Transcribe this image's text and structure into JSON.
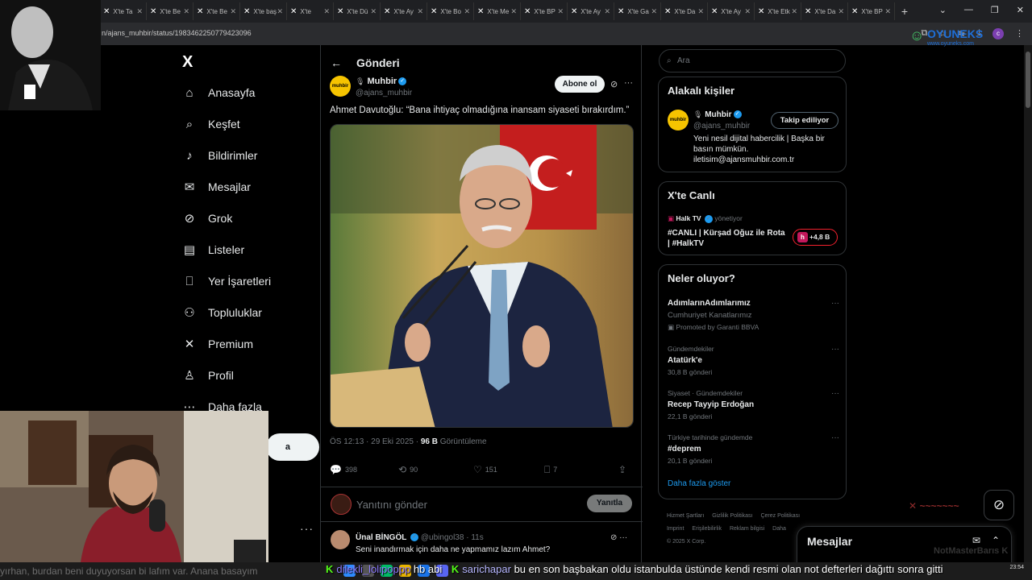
{
  "browser": {
    "tabs": [
      "X'te Ta",
      "X'te Be",
      "X'te Be",
      "X'te baş",
      "X'te",
      "X'te Dü",
      "X'te Ay",
      "X'te Bo",
      "X'te Me",
      "X'te BP",
      "X'te Ay",
      "X'te Ga",
      "X'te Da",
      "X'te Ay",
      "X'te Etk",
      "X'te Da",
      "X'te BP"
    ],
    "url": "n/ajans_muhbir/status/1983462250779423096",
    "profile_initial": "c"
  },
  "nav": {
    "logo": "X",
    "items": [
      {
        "label": "Anasayfa",
        "icon": "home-icon",
        "glyph": "⌂"
      },
      {
        "label": "Keşfet",
        "icon": "search-icon",
        "glyph": "⌕"
      },
      {
        "label": "Bildirimler",
        "icon": "bell-icon",
        "glyph": "♪"
      },
      {
        "label": "Mesajlar",
        "icon": "mail-icon",
        "glyph": "✉"
      },
      {
        "label": "Grok",
        "icon": "grok-icon",
        "glyph": "⊘"
      },
      {
        "label": "Listeler",
        "icon": "list-icon",
        "glyph": "▤"
      },
      {
        "label": "Yer İşaretleri",
        "icon": "bookmark-icon",
        "glyph": "⎕"
      },
      {
        "label": "Topluluklar",
        "icon": "communities-icon",
        "glyph": "⚇"
      },
      {
        "label": "Premium",
        "icon": "x-premium-icon",
        "glyph": "✕"
      },
      {
        "label": "Profil",
        "icon": "profile-icon",
        "glyph": "♙"
      },
      {
        "label": "Daha fazla",
        "icon": "more-icon",
        "glyph": "⋯"
      }
    ],
    "post_button": "a",
    "account_more": "···"
  },
  "main": {
    "title": "Gönderi",
    "author": {
      "name": "Muhbir",
      "handle": "@ajans_muhbir",
      "avatar_text": "muhbir"
    },
    "subscribe": "Abone ol",
    "text": "Ahmet Davutoğlu: “Bana ihtiyaç olmadığına inansam siyaseti bırakırdım.”",
    "time": "ÖS 12:13 · 29 Eki 2025 · ",
    "views": "96 B",
    "views_label": " Görüntüleme",
    "stats": {
      "replies": "398",
      "reposts": "90",
      "likes": "151",
      "bookmarks": "7"
    },
    "reply_placeholder": "Yanıtını gönder",
    "reply_button": "Yanıtla",
    "reply": {
      "name": "Ünal BİNGÖL",
      "handle": "@ubingol38 · 11s",
      "text": "Seni inandırmak için daha ne yapmamız lazım Ahmet?"
    }
  },
  "right": {
    "search_placeholder": "Ara",
    "related": {
      "title": "Alakalı kişiler",
      "name": "Muhbir",
      "handle": "@ajans_muhbir",
      "follow": "Takip ediliyor",
      "bio": "Yeni nesil dijital habercilik | Başka bir basın mümkün. iletisim@ajansmuhbir.com.tr"
    },
    "live": {
      "title": "X'te Canlı",
      "source": "Halk TV",
      "role": "yönetiyor",
      "stream_title": "#CANLI | Kürşad Oğuz ile Rota | #HalkTV",
      "badge_logo": "h",
      "listeners": "+4,8 B"
    },
    "trends": {
      "title": "Neler oluyor?",
      "items": [
        {
          "context": "",
          "title": "AdımlarınAdımlarımız",
          "count": "Cumhuriyet Kanatlarımız",
          "promo": "Promoted by Garanti BBVA"
        },
        {
          "context": "Gündemdekiler",
          "title": "Atatürk'e",
          "count": "30,8 B gönderi"
        },
        {
          "context": "Siyaset · Gündemdekiler",
          "title": "Recep Tayyip Erdoğan",
          "count": "22,1 B gönderi"
        },
        {
          "context": "Türkiye tarihinde gündemde",
          "title": "#deprem",
          "count": "20,1 B gönderi"
        }
      ],
      "show_more": "Daha fazla göster"
    },
    "footer": [
      "Hizmet Şartları",
      "Gizlilik Politikası",
      "Çerez Politikası",
      "Imprint",
      "Erişilebilirlik",
      "Reklam bilgisi",
      "Daha",
      "© 2025 X Corp."
    ]
  },
  "messages": {
    "title": "Mesajlar"
  },
  "overlay": {
    "brand": "OYUNEKS",
    "brand_url": "www.oyuneks.com",
    "watermark": "NotMasterBarıs K",
    "ticker_left": "yırhan, burdan beni duyuyorsan bi lafım var. Anana basayım",
    "chat": [
      {
        "user": "dilekli_lolipoppp",
        "msg": "hb abi"
      },
      {
        "user": "sarichapar",
        "msg": "bu en son başbakan oldu istanbulda üstünde kendi resmi olan not defterleri dağıttı sonra gitti"
      }
    ],
    "clock": "23:54"
  },
  "colors": {
    "accent": "#1d9bf0",
    "background": "#000000",
    "live_red": "#f4212e",
    "kick_green": "#53fc18"
  }
}
